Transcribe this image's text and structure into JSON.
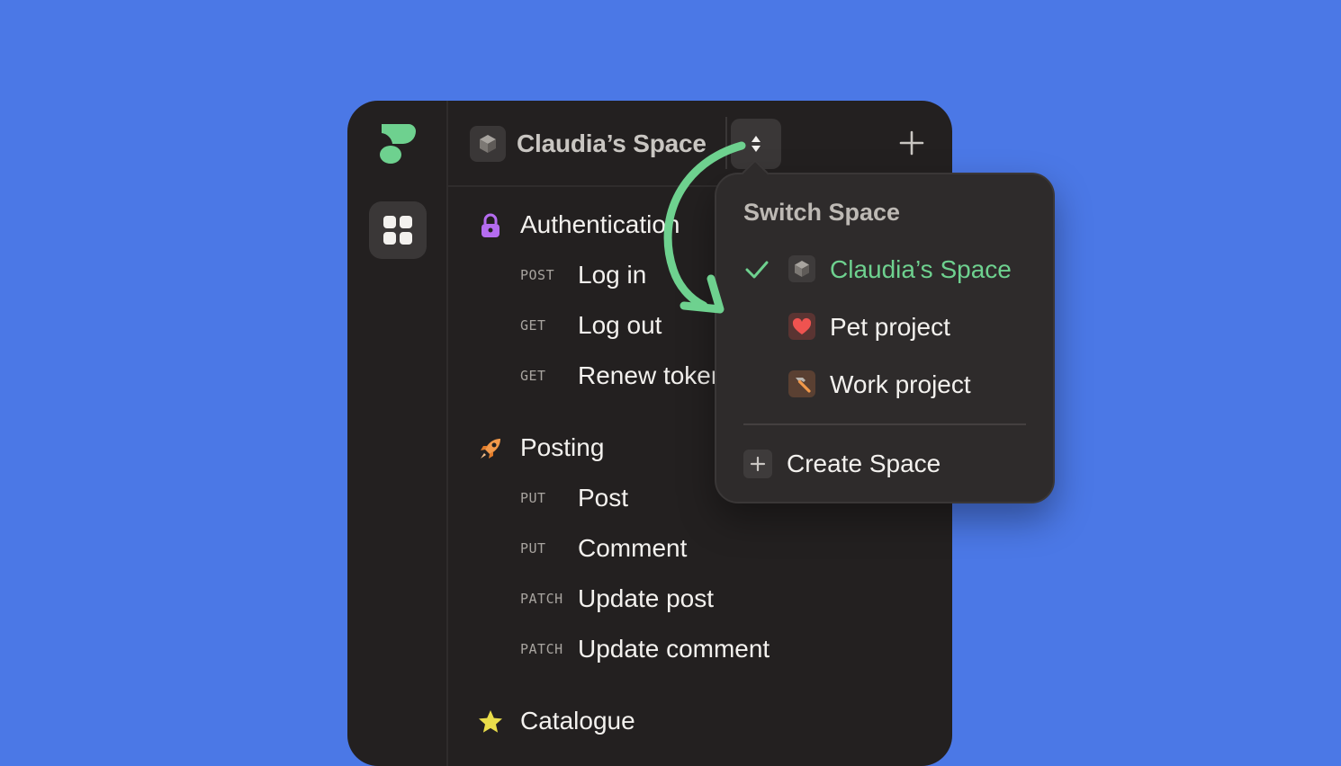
{
  "header": {
    "space_name": "Claudia’s Space",
    "space_icon": "box-icon",
    "switch_icon": "up-down-chevron-icon",
    "add_icon": "plus-icon"
  },
  "rail": {
    "logo_icon": "app-logo",
    "apps_icon": "grid-icon"
  },
  "sections": [
    {
      "label": "Authentication",
      "icon": "lock-icon",
      "endpoints": [
        {
          "method": "POST",
          "name": "Log in"
        },
        {
          "method": "GET",
          "name": "Log out"
        },
        {
          "method": "GET",
          "name": "Renew token"
        }
      ]
    },
    {
      "label": "Posting",
      "icon": "rocket-icon",
      "endpoints": [
        {
          "method": "PUT",
          "name": "Post"
        },
        {
          "method": "PUT",
          "name": "Comment"
        },
        {
          "method": "PATCH",
          "name": "Update post"
        },
        {
          "method": "PATCH",
          "name": "Update comment"
        }
      ]
    },
    {
      "label": "Catalogue",
      "icon": "star-icon",
      "endpoints": []
    }
  ],
  "dropdown": {
    "title": "Switch Space",
    "items": [
      {
        "label": "Claudia’s Space",
        "icon": "box-icon",
        "selected": true
      },
      {
        "label": "Pet project",
        "icon": "heart-icon",
        "selected": false
      },
      {
        "label": "Work project",
        "icon": "hammer-icon",
        "selected": false
      }
    ],
    "create_label": "Create Space"
  },
  "colors": {
    "background": "#4b78e6",
    "panel": "#232020",
    "accent_green": "#6ed18f",
    "lock_purple": "#b56cf0",
    "rocket_orange": "#f2994a",
    "star_yellow": "#e9dd4a",
    "heart_red": "#ef5350"
  }
}
